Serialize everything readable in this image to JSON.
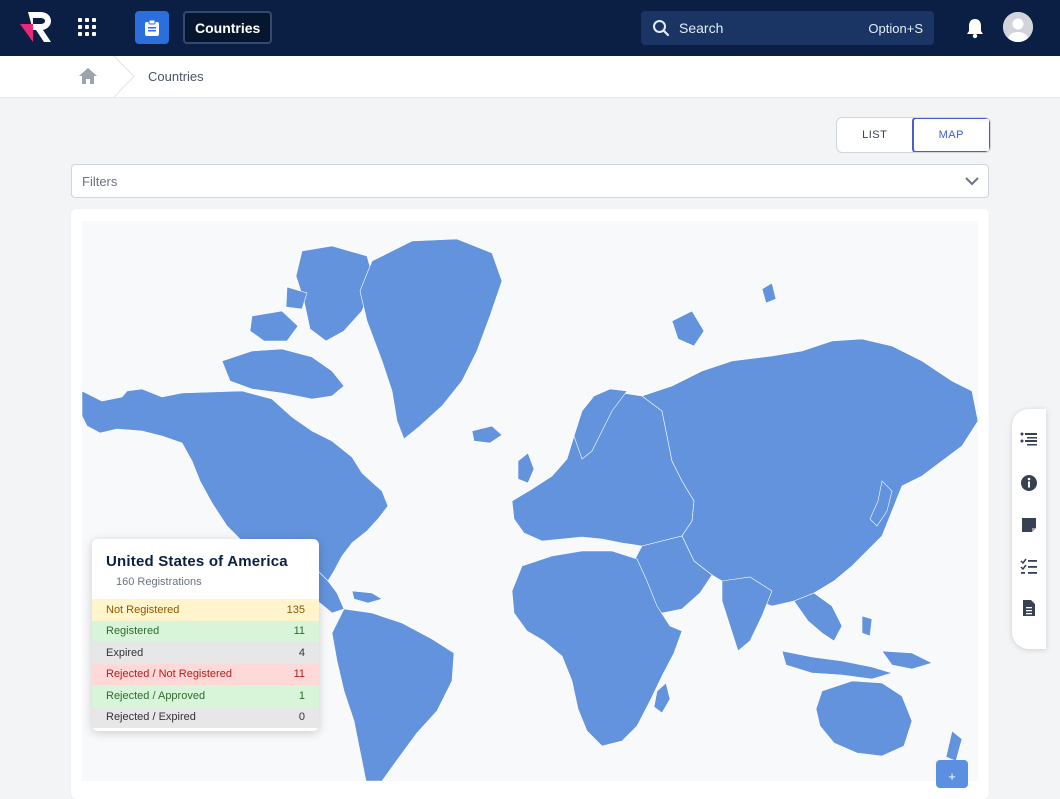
{
  "header": {
    "module_title": "Countries",
    "search": {
      "label": "Search",
      "shortcut": "Option+S"
    },
    "colors": {
      "bar": "#0b1f45",
      "accent": "#2a6fdb",
      "logo_pink": "#e8297a"
    }
  },
  "breadcrumb": {
    "current": "Countries"
  },
  "view_toggle": {
    "options": [
      "LIST",
      "MAP"
    ],
    "selected": "MAP"
  },
  "filters": {
    "placeholder": "Filters"
  },
  "map": {
    "fill_color": "#6293dc"
  },
  "tooltip": {
    "country": "United States of America",
    "registrations": "160 Registrations",
    "rows": [
      {
        "label": "Not Registered",
        "value": "135",
        "tone": "yellow"
      },
      {
        "label": "Registered",
        "value": "11",
        "tone": "green"
      },
      {
        "label": "Expired",
        "value": "4",
        "tone": "gray"
      },
      {
        "label": "Rejected / Not Registered",
        "value": "11",
        "tone": "red"
      },
      {
        "label": "Rejected / Approved",
        "value": "1",
        "tone": "green"
      },
      {
        "label": "Rejected / Expired",
        "value": "0",
        "tone": "gray"
      }
    ]
  },
  "zoom": {
    "plus": "+"
  },
  "right_rail": {
    "icons": [
      "list-icon",
      "info-icon",
      "note-icon",
      "checklist-icon",
      "document-icon"
    ]
  }
}
